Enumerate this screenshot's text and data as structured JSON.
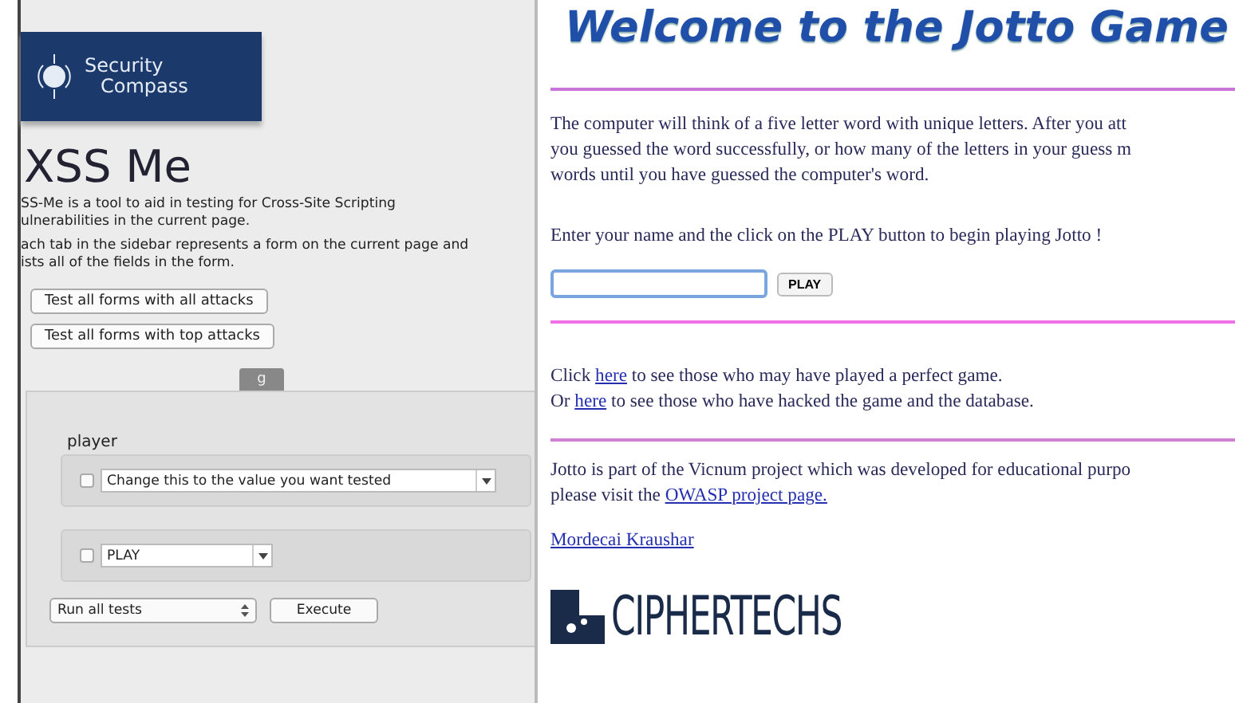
{
  "sidebar": {
    "logo": {
      "line_1": "Security",
      "line_2": "Compass"
    },
    "title": "XSS Me",
    "paragraphs": [
      [
        "SS-Me is a tool to aid in testing for Cross-Site Scripting",
        "ulnerabilities in the current page."
      ],
      [
        "ach tab in the sidebar represents a form on the current page and",
        "ists all of the fields in the form."
      ]
    ],
    "buttons": [
      "Test all forms with all attacks",
      "Test all forms with top attacks"
    ],
    "form_tab": {
      "label": "g",
      "selected": true
    },
    "field_label": "player",
    "fields": [
      {
        "value": "Change this to the value you want tested",
        "checked": false,
        "wide": true
      },
      {
        "value": "PLAY",
        "checked": false,
        "wide": false
      }
    ],
    "run_select": "Run all tests",
    "execute_button": "Execute"
  },
  "page": {
    "title": "Welcome to the Jotto Game",
    "intro_lines": [
      "The computer will think of a five letter word with unique letters. After you att",
      "you guessed the word successfully, or how many of the letters in your guess m",
      "words until you have guessed the computer's word."
    ],
    "prompt": "Enter your name and the click on the PLAY button to begin playing Jotto !",
    "play_button": "PLAY",
    "link_lines": [
      {
        "before": "Click ",
        "link": "here",
        "after": " to see those who may have played a perfect game."
      },
      {
        "before": "Or ",
        "link": "here",
        "after": " to see those who have hacked the game and the database."
      }
    ],
    "about_line": "Jotto is part of the Vicnum project which was developed for educational purpo",
    "visit": {
      "before": "please visit the ",
      "link": "OWASP project page."
    },
    "author_link": "Mordecai Kraushar",
    "footer_logo": "CIPHERTECHS"
  }
}
